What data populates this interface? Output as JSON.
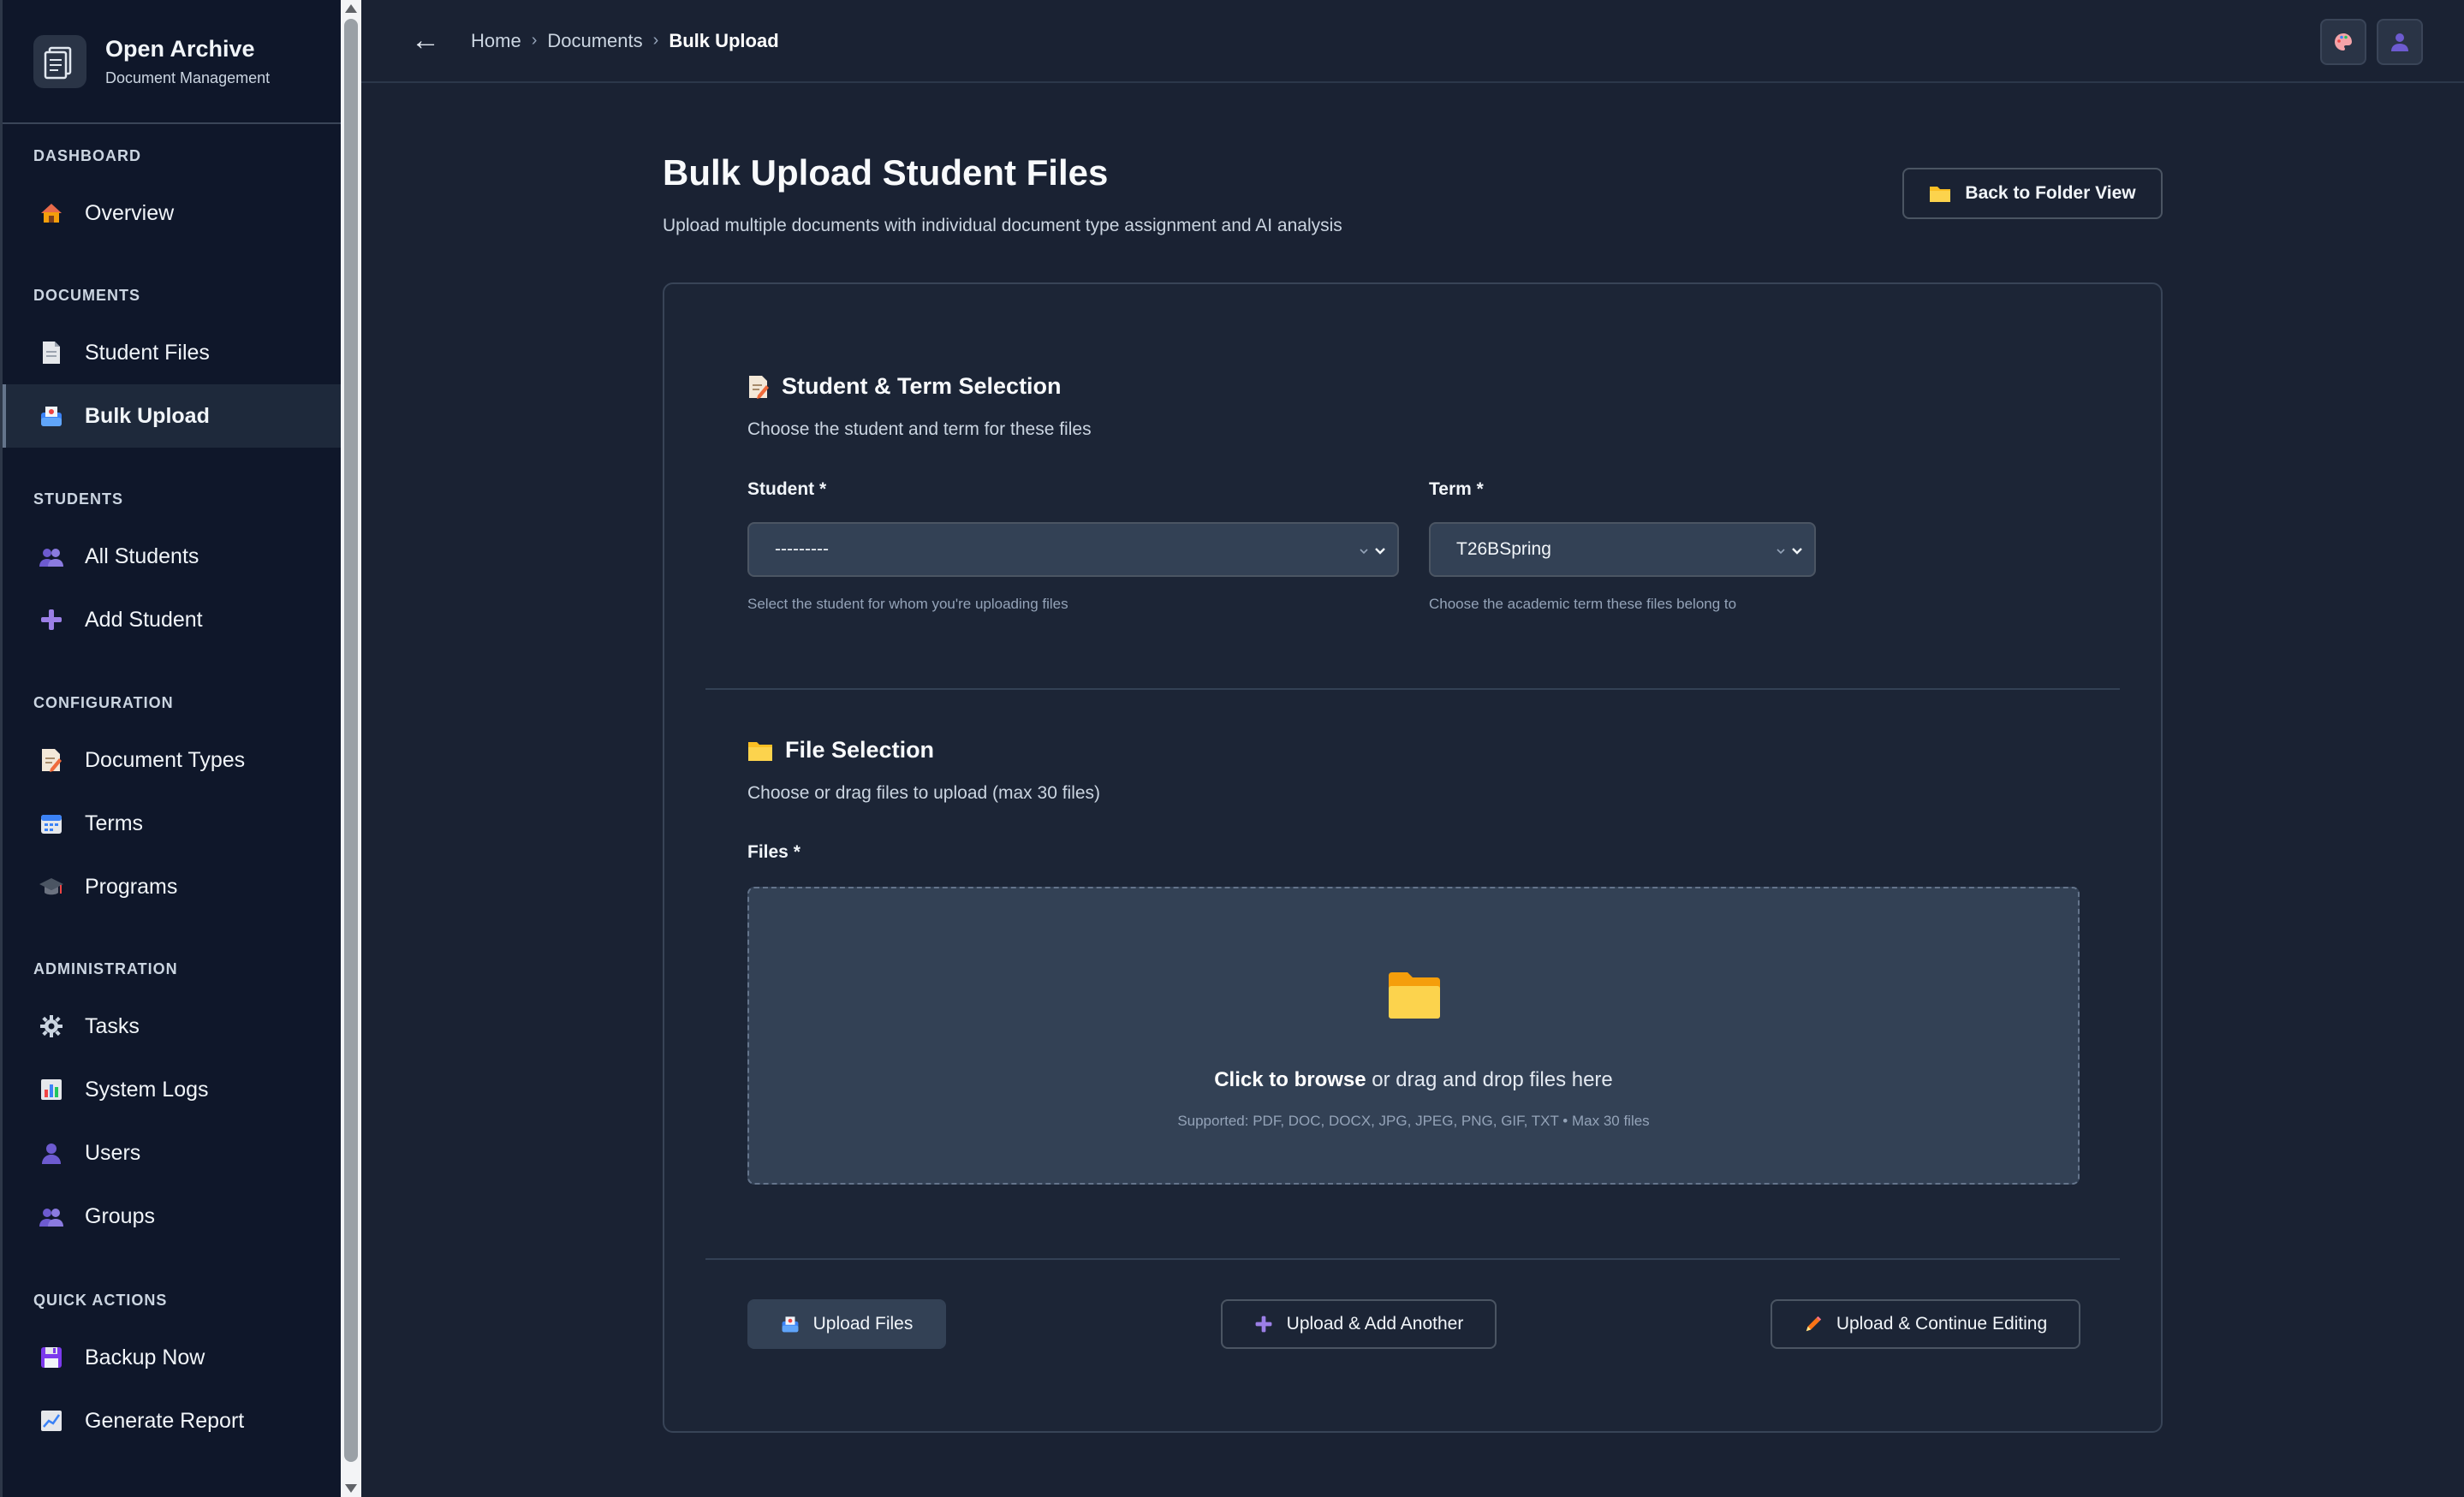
{
  "brand": {
    "title": "Open Archive",
    "subtitle": "Document Management"
  },
  "sidebar": {
    "sections": [
      {
        "title": "DASHBOARD",
        "items": [
          {
            "label": "Overview",
            "icon": "house-icon"
          }
        ]
      },
      {
        "title": "DOCUMENTS",
        "items": [
          {
            "label": "Student Files",
            "icon": "document-icon"
          },
          {
            "label": "Bulk Upload",
            "icon": "outbox-icon",
            "active": true
          }
        ]
      },
      {
        "title": "STUDENTS",
        "items": [
          {
            "label": "All Students",
            "icon": "users-icon"
          },
          {
            "label": "Add Student",
            "icon": "plus-icon"
          }
        ]
      },
      {
        "title": "CONFIGURATION",
        "items": [
          {
            "label": "Document Types",
            "icon": "memo-icon"
          },
          {
            "label": "Terms",
            "icon": "calendar-icon"
          },
          {
            "label": "Programs",
            "icon": "graduation-cap-icon"
          }
        ]
      },
      {
        "title": "ADMINISTRATION",
        "items": [
          {
            "label": "Tasks",
            "icon": "gear-icon"
          },
          {
            "label": "System Logs",
            "icon": "bar-chart-icon"
          },
          {
            "label": "Users",
            "icon": "user-icon"
          },
          {
            "label": "Groups",
            "icon": "users-icon"
          }
        ]
      },
      {
        "title": "QUICK ACTIONS",
        "items": [
          {
            "label": "Backup Now",
            "icon": "floppy-disk-icon"
          },
          {
            "label": "Generate Report",
            "icon": "line-chart-icon"
          }
        ]
      }
    ]
  },
  "breadcrumb": {
    "items": [
      "Home",
      "Documents",
      "Bulk Upload"
    ],
    "separator": "›"
  },
  "page": {
    "title": "Bulk Upload Student Files",
    "subtitle": "Upload multiple documents with individual document type assignment and AI analysis",
    "back_button": "Back to Folder View"
  },
  "selection": {
    "title": "Student & Term Selection",
    "subtitle": "Choose the student and term for these files",
    "student_label": "Student *",
    "student_value": "---------",
    "student_help": "Select the student for whom you're uploading files",
    "term_label": "Term *",
    "term_value": "T26BSpring",
    "term_help": "Choose the academic term these files belong to"
  },
  "files": {
    "title": "File Selection",
    "subtitle": "Choose or drag files to upload (max 30 files)",
    "label": "Files *",
    "drop_browse": "Click to browse",
    "drop_rest": " or drag and drop files here",
    "supported": "Supported: PDF, DOC, DOCX, JPG, JPEG, PNG, GIF, TXT • Max 30 files"
  },
  "actions": {
    "upload": "Upload Files",
    "upload_add": "Upload & Add Another",
    "upload_continue": "Upload & Continue Editing"
  },
  "colors": {
    "background": "#1a2233",
    "sidebar": "#0f172a",
    "card": "#1c2536",
    "accent_folder": "#fbbf24"
  }
}
